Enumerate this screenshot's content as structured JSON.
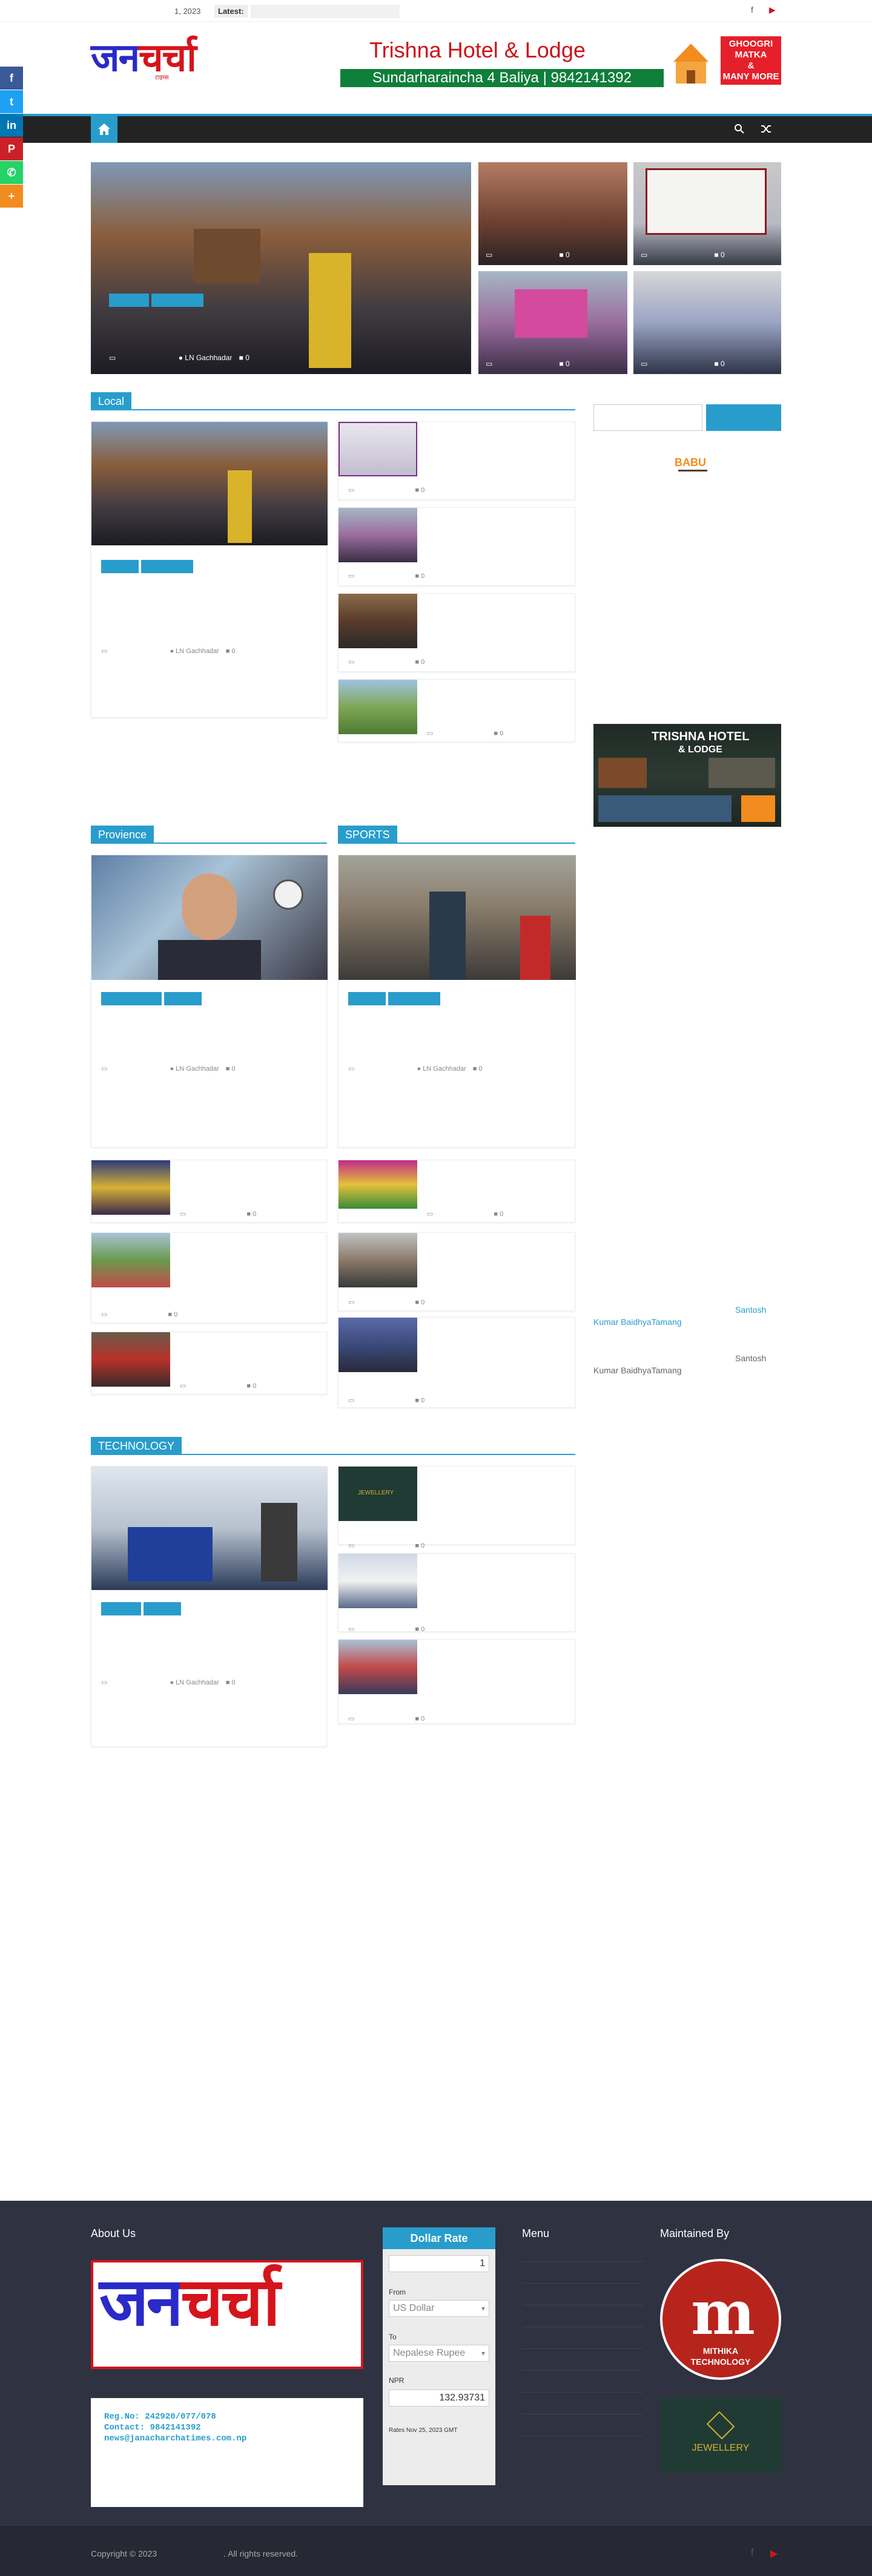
{
  "topbar": {
    "date": "1, 2023",
    "latest_label": "Latest:",
    "social": {
      "facebook": "f",
      "youtube": "▶"
    }
  },
  "header": {
    "logo_text_blue": "जन",
    "logo_text_red": "चर्चा",
    "logo_sub": "टाइम्स"
  },
  "ad_banner": {
    "title": "Trishna Hotel & Lodge",
    "strip": "Sundarharaincha 4 Baliya | 9842141392",
    "badge_lines": [
      "GHOOGRI",
      "MATKA",
      "&",
      "MANY MORE"
    ]
  },
  "nav": {
    "home_icon": "home-icon",
    "search_icon": "search-icon",
    "random_icon": "shuffle-icon"
  },
  "share_buttons": [
    {
      "name": "facebook",
      "glyph": "f",
      "color": "#3b5998"
    },
    {
      "name": "twitter",
      "glyph": "t",
      "color": "#1da1f2"
    },
    {
      "name": "linkedin",
      "glyph": "in",
      "color": "#0077b5"
    },
    {
      "name": "pinterest",
      "glyph": "P",
      "color": "#cb2027"
    },
    {
      "name": "whatsapp",
      "glyph": "✆",
      "color": "#25d366"
    },
    {
      "name": "more",
      "glyph": "+",
      "color": "#f28c1f"
    }
  ],
  "featured": {
    "main_author": "LN Gachhadar",
    "main_comments": "0",
    "small_comments": [
      "0",
      "0",
      "0",
      "0"
    ]
  },
  "sections": {
    "local": "Local",
    "provience": "Provience",
    "sports": "SPORTS",
    "technology": "TECHNOLOGY"
  },
  "local": {
    "main_author": "LN Gachhadar",
    "main_comments": "0",
    "list_comments": [
      "0",
      "0",
      "0",
      "0"
    ]
  },
  "provience": {
    "main_author": "LN Gachhadar",
    "main_comments": "0",
    "list_comments": [
      "0",
      "0",
      "0"
    ]
  },
  "sports": {
    "main_author": "LN Gachhadar",
    "main_comments": "0",
    "list_comments": [
      "0",
      "0",
      "0"
    ]
  },
  "technology": {
    "main_author": "LN Gachhadar",
    "main_comments": "0",
    "list_comments": [
      "0",
      "0",
      "0"
    ]
  },
  "sidebar": {
    "ad_title": "TRISHNA HOTEL",
    "ad_sub": "& LODGE",
    "authors": [
      {
        "first": "Santosh",
        "last": "Kumar BaidhyaTamang"
      },
      {
        "first": "Santosh",
        "last": "Kumar BaidhyaTamang"
      }
    ]
  },
  "footer": {
    "about_title": "About Us",
    "dollar_title": "Dollar Rate",
    "menu_title": "Menu",
    "maintained_title": "Maintained By",
    "reg": "Reg.No: 242920/077/078",
    "contact": "Contact: 9842141392",
    "email": "news@janacharchatimes.com.np",
    "amount": "1",
    "from_label": "From",
    "from_value": "US Dollar",
    "to_label": "To",
    "to_value": "Nepalese Rupee",
    "npr_label": "NPR",
    "result": "132.93731",
    "rates_note": "Rates Nov 25, 2023 GMT",
    "maintainer_line1": "MITHIKA",
    "maintainer_line2": "TECHNOLOGY",
    "jewellery": "JEWELLERY"
  },
  "bottom": {
    "copyright": "Copyright © 2023",
    "rights": ". All rights reserved."
  },
  "colors": {
    "accent": "#289dcc",
    "brand_blue": "#2a2ac8",
    "brand_red": "#d6141c"
  }
}
